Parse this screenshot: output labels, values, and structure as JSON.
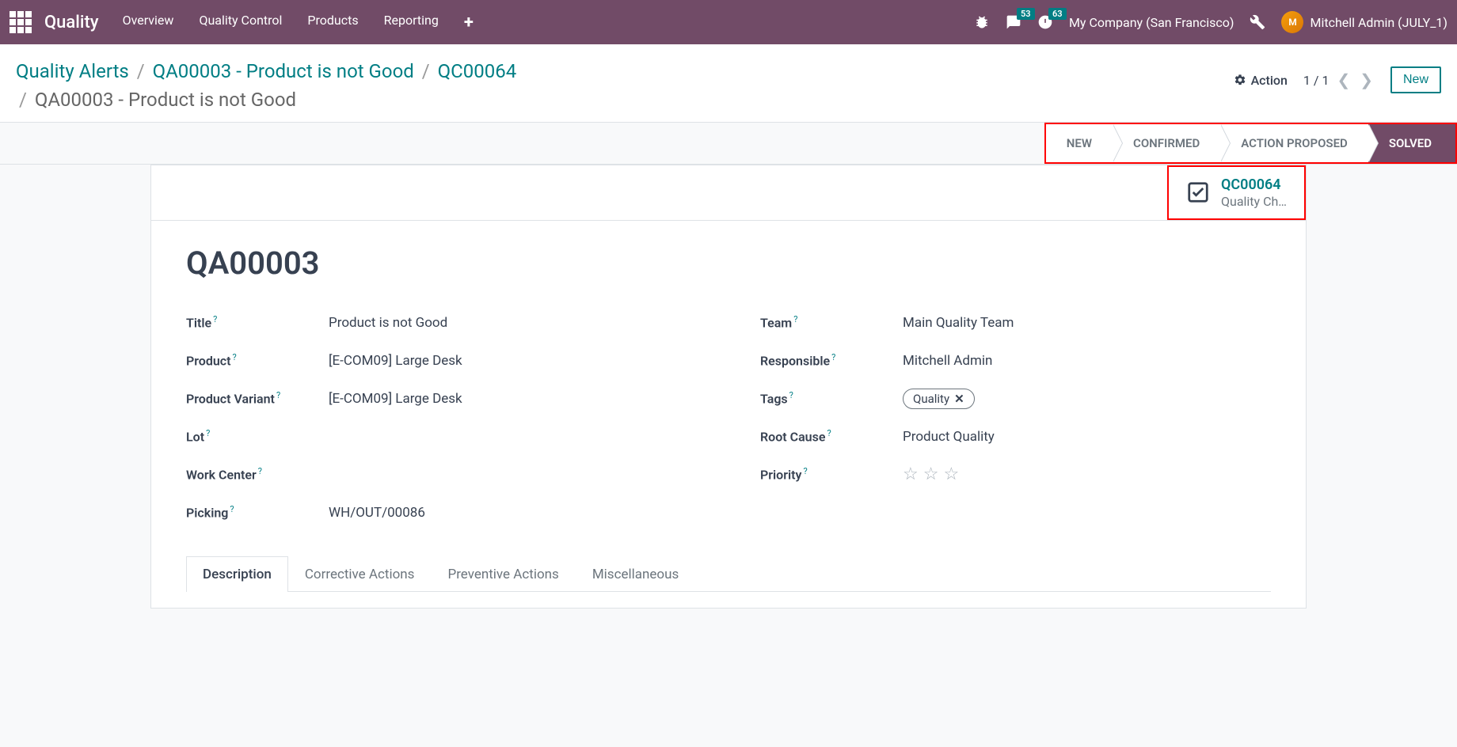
{
  "header": {
    "app_title": "Quality",
    "menu": [
      "Overview",
      "Quality Control",
      "Products",
      "Reporting"
    ],
    "chat_badge": "53",
    "clock_badge": "63",
    "company": "My Company (San Francisco)",
    "user_name": "Mitchell Admin (JULY_1)"
  },
  "breadcrumbs": {
    "items": [
      {
        "label": "Quality Alerts",
        "link": true
      },
      {
        "label": "QA00003 - Product is not Good",
        "link": true
      },
      {
        "label": "QC00064",
        "link": true
      }
    ],
    "current": "QA00003 - Product is not Good"
  },
  "controls": {
    "action_label": "Action",
    "pager": "1 / 1",
    "new_label": "New"
  },
  "statusbar": {
    "stages": [
      "NEW",
      "CONFIRMED",
      "ACTION PROPOSED",
      "SOLVED"
    ],
    "active": "SOLVED"
  },
  "stat_button": {
    "ref": "QC00064",
    "sub": "Quality Ch…"
  },
  "record": {
    "id": "QA00003",
    "labels": {
      "title": "Title",
      "product": "Product",
      "product_variant": "Product Variant",
      "lot": "Lot",
      "work_center": "Work Center",
      "picking": "Picking",
      "team": "Team",
      "responsible": "Responsible",
      "tags": "Tags",
      "root_cause": "Root Cause",
      "priority": "Priority"
    },
    "values": {
      "title": "Product is not Good",
      "product": "[E-COM09] Large Desk",
      "product_variant": "[E-COM09] Large Desk",
      "lot": "",
      "work_center": "",
      "picking": "WH/OUT/00086",
      "team": "Main Quality Team",
      "responsible": "Mitchell Admin",
      "tags": [
        "Quality"
      ],
      "root_cause": "Product Quality"
    }
  },
  "tabs": [
    "Description",
    "Corrective Actions",
    "Preventive Actions",
    "Miscellaneous"
  ],
  "active_tab": "Description"
}
